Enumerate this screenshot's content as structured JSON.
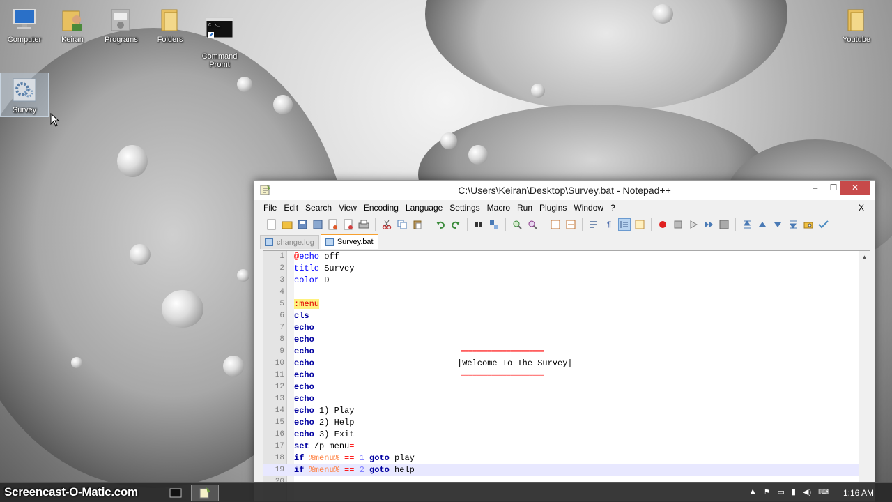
{
  "desktop": {
    "icons": [
      {
        "label": "Computer"
      },
      {
        "label": "Keiran"
      },
      {
        "label": "Programs"
      },
      {
        "label": "Folders"
      },
      {
        "label": "Command\nPromt"
      },
      {
        "label": "Survey"
      },
      {
        "label": "Youtube"
      }
    ]
  },
  "window": {
    "title": "C:\\Users\\Keiran\\Desktop\\Survey.bat - Notepad++",
    "minimize": "–",
    "maximize": "☐",
    "close": "✕",
    "menu": [
      "File",
      "Edit",
      "Search",
      "View",
      "Encoding",
      "Language",
      "Settings",
      "Macro",
      "Run",
      "Plugins",
      "Window",
      "?"
    ],
    "menu_close": "X",
    "tabs": [
      {
        "label": "change.log",
        "active": false
      },
      {
        "label": "Survey.bat",
        "active": true
      }
    ],
    "line_numbers": [
      "1",
      "2",
      "3",
      "4",
      "5",
      "6",
      "7",
      "8",
      "9",
      "10",
      "11",
      "12",
      "13",
      "14",
      "15",
      "16",
      "17",
      "18",
      "19",
      "20"
    ],
    "code": {
      "l1_at": "@",
      "l1_kw": "echo",
      "l1_txt": " off",
      "l2_kw": "title",
      "l2_txt": " Survey",
      "l3_kw": "color",
      "l3_txt": " D",
      "l5_lbl": ":menu",
      "l6_kw": "cls",
      "echo": "echo",
      "l9_box": "══════════════════════",
      "l10_box": "|Welcome To The Survey|",
      "l11_box": "══════════════════════",
      "l14_txt": " 1) Play",
      "l15_txt": " 2) Help",
      "l16_txt": " 3) Exit",
      "l17_kw": "set",
      "l17_txt": " /p menu",
      "l17_op": "=",
      "if": "if",
      "menu_var": " %menu%",
      "eqeq": " ==",
      "l18_num": " 1",
      "l19_num": " 2",
      "goto": " goto",
      "l18_txt": " play",
      "l19_txt": " help"
    }
  },
  "taskbar": {
    "watermark": "Screencast-O-Matic.com",
    "clock": "1:16 AM"
  }
}
